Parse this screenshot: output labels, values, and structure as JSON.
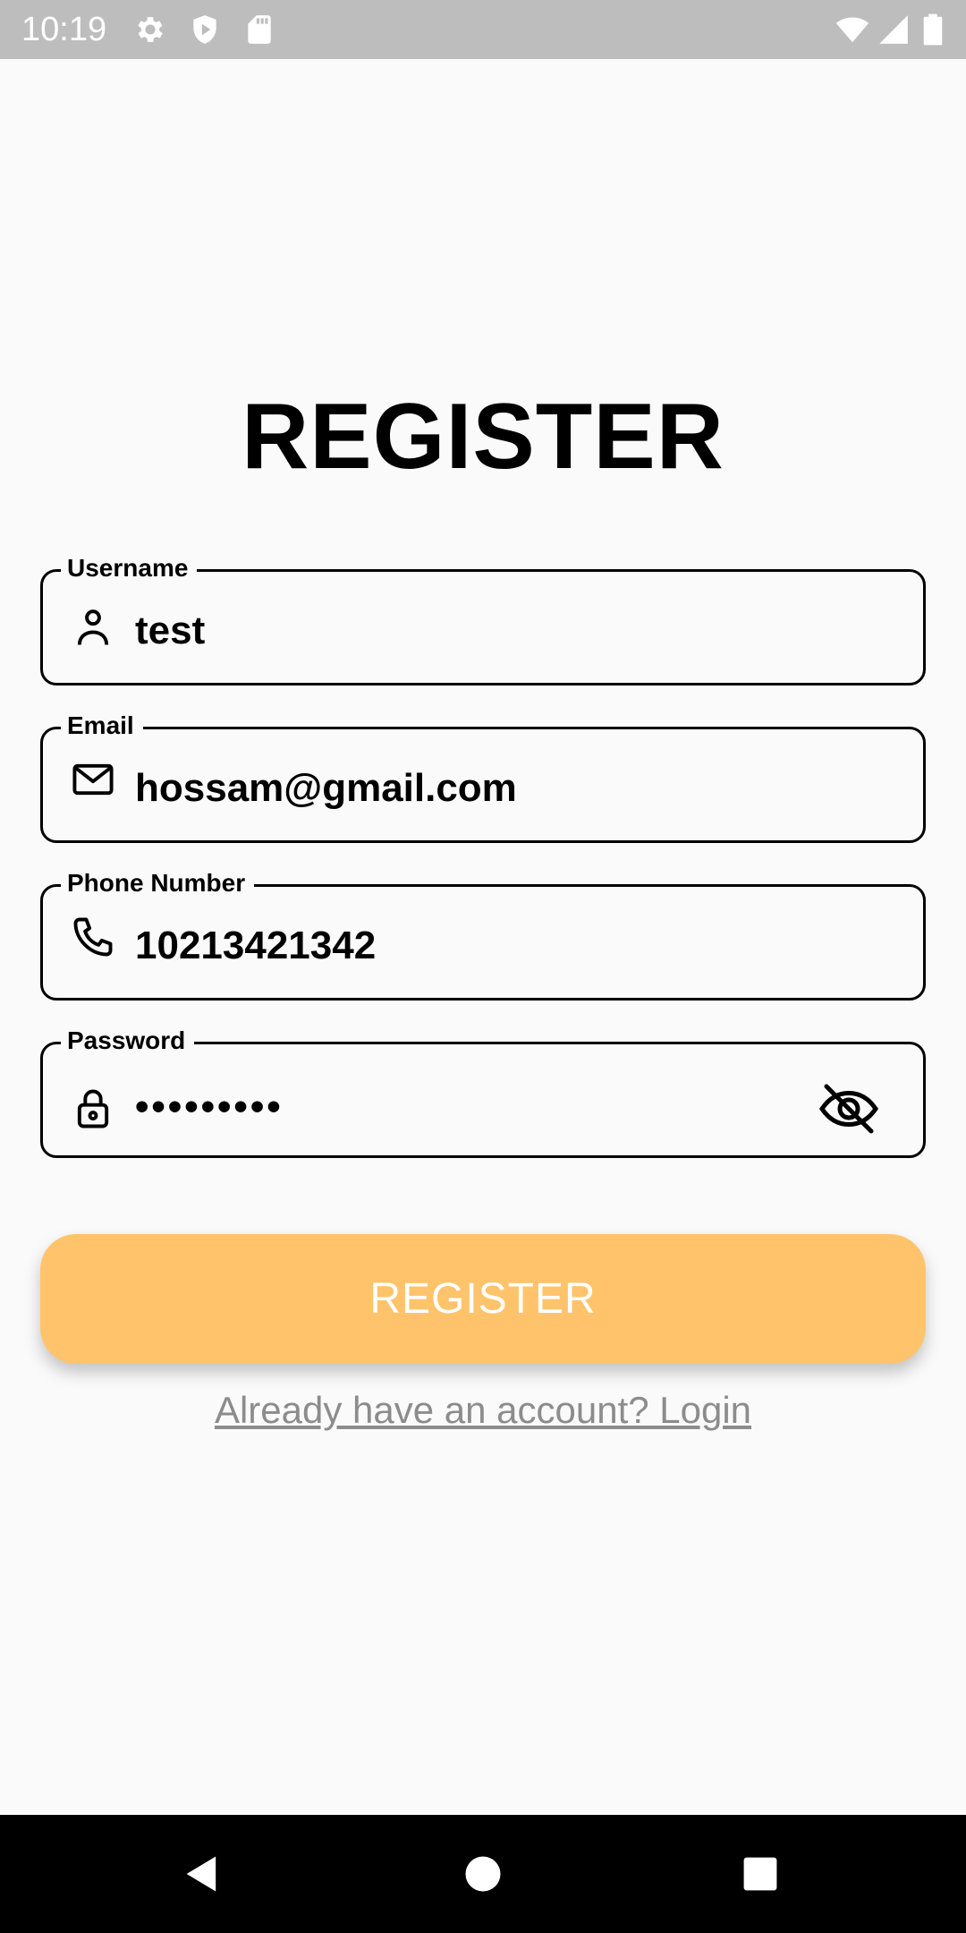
{
  "status_bar": {
    "time": "10:19",
    "icons": [
      "gear-icon",
      "shield-play-icon",
      "sd-card-icon",
      "wifi-icon",
      "signal-icon",
      "battery-icon"
    ]
  },
  "title": "REGISTER",
  "form": {
    "username": {
      "label": "Username",
      "value": "test",
      "icon": "person-icon"
    },
    "email": {
      "label": "Email",
      "value": "hossam@gmail.com",
      "icon": "envelope-icon"
    },
    "phone": {
      "label": "Phone Number",
      "value": "10213421342",
      "icon": "phone-icon"
    },
    "password": {
      "label": "Password",
      "value": "•••••••••",
      "icon": "lock-icon",
      "toggle_icon": "eye-off-icon"
    }
  },
  "register_button": "REGISTER",
  "login_link": "Already have an account? Login",
  "nav": [
    "back-icon",
    "home-icon",
    "recents-icon"
  ],
  "colors": {
    "button": "#ffc46b",
    "status_bar": "#bdbdbd",
    "background": "#fafafa",
    "link": "#8c8c8c"
  }
}
